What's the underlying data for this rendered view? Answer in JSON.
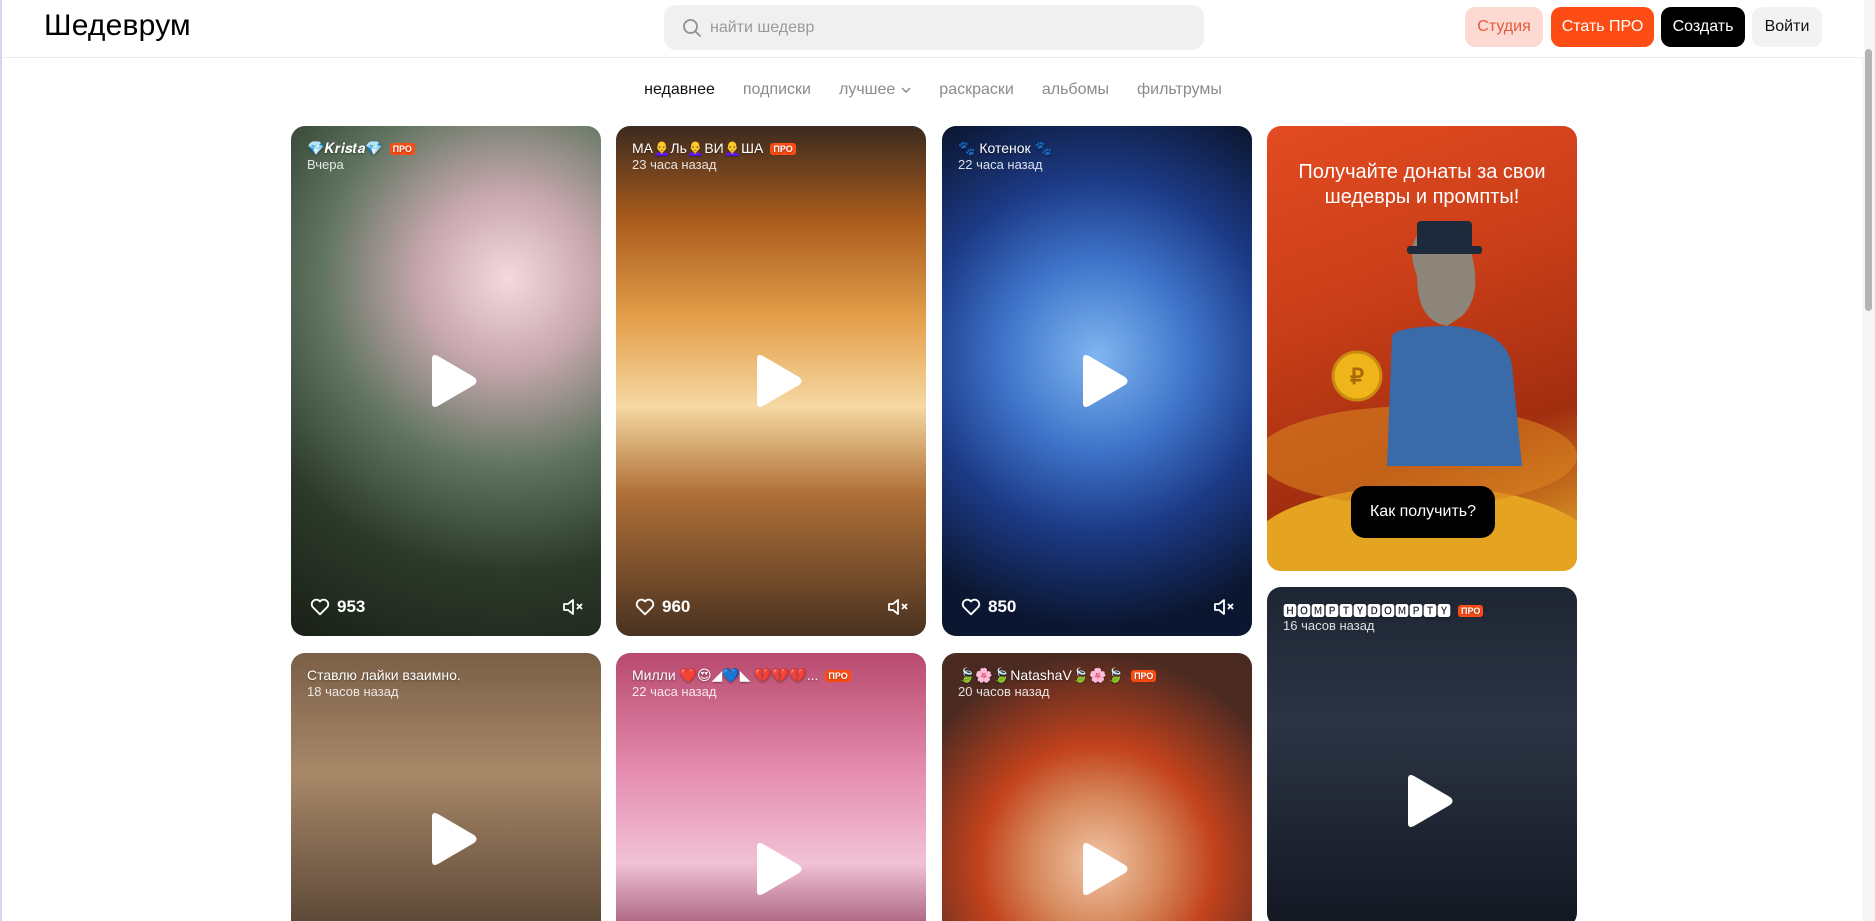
{
  "header": {
    "logo": "Шедеврум",
    "search_placeholder": "найти шедевр",
    "studio_label": "Студия",
    "pro_label": "Стать ПРО",
    "create_label": "Создать",
    "login_label": "Войти"
  },
  "tabs": [
    {
      "label": "недавнее",
      "active": true
    },
    {
      "label": "подписки"
    },
    {
      "label": "лучшее",
      "has_dropdown": true
    },
    {
      "label": "раскраски"
    },
    {
      "label": "альбомы"
    },
    {
      "label": "фильтрумы"
    }
  ],
  "cards": [
    {
      "user": "💎𝑲𝒓𝒊𝒔𝒕𝒂💎",
      "pro": true,
      "time": "Вчера",
      "likes": "953",
      "video": true
    },
    {
      "user": "МА👩‍🦲Ль👩‍🦲ВИ👩‍🦲ША",
      "pro": true,
      "time": "23 часа назад",
      "likes": "960",
      "video": true
    },
    {
      "user": "🐾 Котенок 🐾",
      "pro": false,
      "time": "22 часа назад",
      "likes": "850",
      "video": true
    },
    {
      "user": "Ставлю лайки взаимно.",
      "pro": false,
      "time": "18 часов назад",
      "video": true
    },
    {
      "user": "Милли ❤️😍◢💙◣ 💔💔💔...",
      "pro": true,
      "time": "22 часа назад",
      "video": true
    },
    {
      "user": "🍃🌸🍃NatashaV🍃🌸🍃",
      "pro": true,
      "time": "20 часов назад",
      "video": true
    },
    {
      "user": "🅷🅾🅼🅿🆃🆈🅳🅾🅼🅿🆃🆈",
      "pro": true,
      "time": "16 часов назад",
      "video": true
    }
  ],
  "promo": {
    "title": "Получайте донаты за свои шедевры и промпты!",
    "button": "Как получить?"
  },
  "pro_badge": "ПРО",
  "colors": {
    "accent": "#fd4c14",
    "studio_bg": "#fcd9d3"
  }
}
